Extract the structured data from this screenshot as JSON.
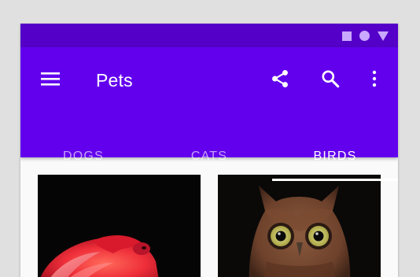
{
  "status_bar": {
    "icons": [
      "square-icon",
      "circle-icon",
      "triangle-icon"
    ],
    "color": "#5400c8"
  },
  "app_bar": {
    "title": "Pets",
    "color": "#6200ee",
    "actions": [
      "menu-icon",
      "share-icon",
      "search-icon",
      "more-vert-icon"
    ]
  },
  "tabs": [
    {
      "label": "DOGS",
      "active": false
    },
    {
      "label": "CATS",
      "active": false
    },
    {
      "label": "BIRDS",
      "active": true
    }
  ],
  "grid": {
    "items": [
      {
        "image": "flamingo-image"
      },
      {
        "image": "owl-image"
      }
    ]
  }
}
